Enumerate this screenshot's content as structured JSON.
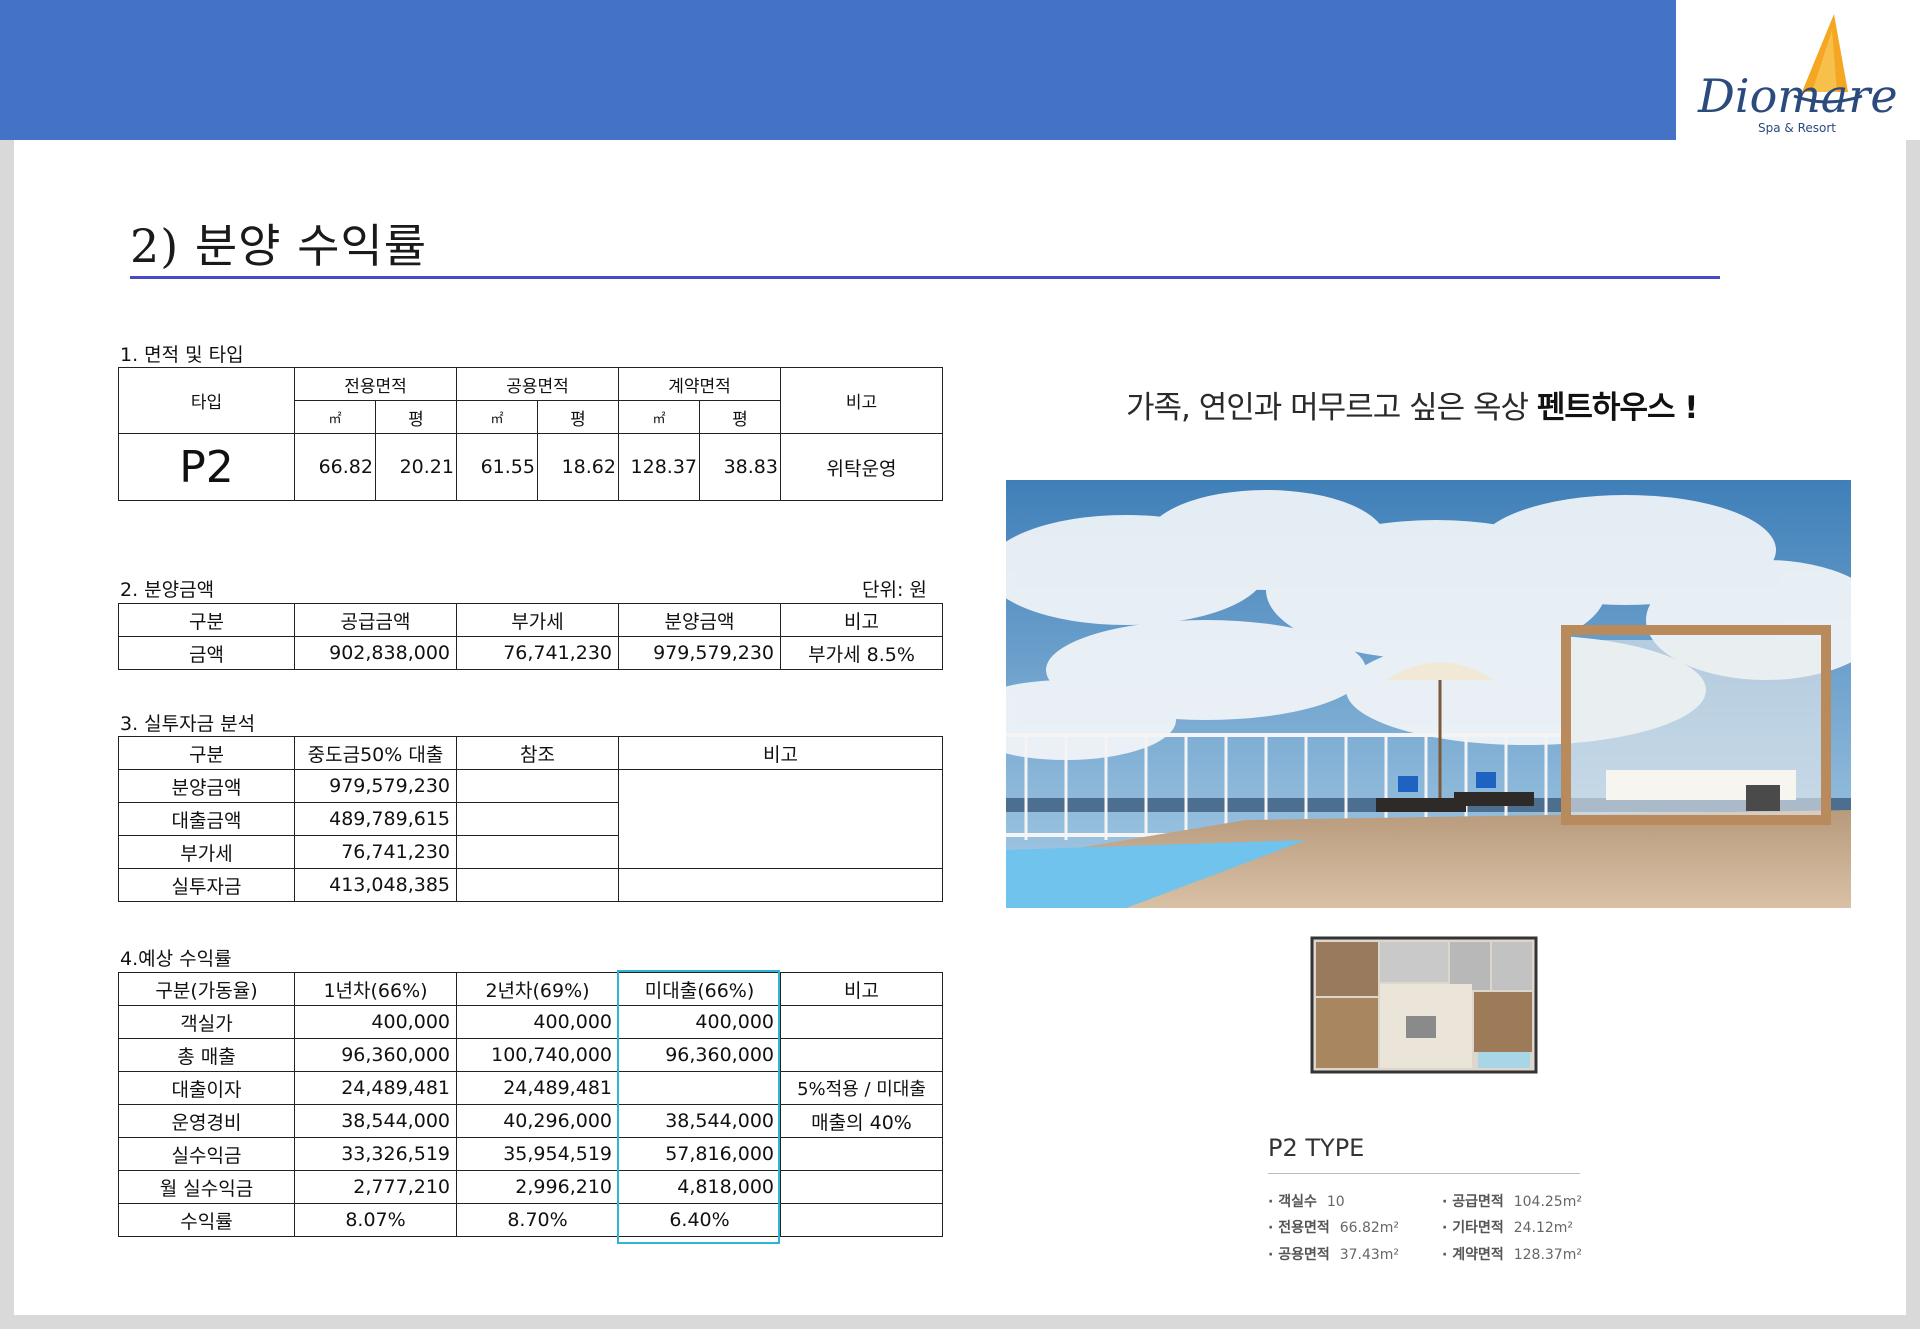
{
  "brand": {
    "name": "Diomare",
    "tagline": "Spa & Resort",
    "colors": {
      "header": "#4472c4",
      "logo_blue": "#2b4a7e",
      "sail_orange": "#f5a623"
    }
  },
  "page_title": "2) 분양 수익률",
  "area": {
    "label": "1. 면적 및 타입",
    "headers": {
      "type": "타입",
      "exclusive": "전용면적",
      "common": "공용면적",
      "contract": "계약면적",
      "note": "비고",
      "sqm": "㎡",
      "pyeong": "평"
    },
    "row": {
      "type": "P2",
      "exclusive_sqm": "66.82",
      "exclusive_py": "20.21",
      "common_sqm": "61.55",
      "common_py": "18.62",
      "contract_sqm": "128.37",
      "contract_py": "38.83",
      "note": "위탁운영"
    }
  },
  "price": {
    "label": "2. 분양금액",
    "unit": "단위: 원",
    "headers": [
      "구분",
      "공급금액",
      "부가세",
      "분양금액",
      "비고"
    ],
    "row": [
      "금액",
      "902,838,000",
      "76,741,230",
      "979,579,230",
      "부가세 8.5%"
    ]
  },
  "invest": {
    "label": "3. 실투자금 분석",
    "headers": [
      "구분",
      "중도금50% 대출",
      "참조",
      "비고"
    ],
    "rows": [
      [
        "분양금액",
        "979,579,230"
      ],
      [
        "대출금액",
        "489,789,615"
      ],
      [
        "부가세",
        "76,741,230"
      ],
      [
        "실투자금",
        "413,048,385"
      ]
    ]
  },
  "returns": {
    "label": "4.예상 수익률",
    "headers": [
      "구분(가동율)",
      "1년차(66%)",
      "2년차(69%)",
      "미대출(66%)",
      "비고"
    ],
    "rows": [
      [
        "객실가",
        "400,000",
        "400,000",
        "400,000",
        ""
      ],
      [
        "총 매출",
        "96,360,000",
        "100,740,000",
        "96,360,000",
        ""
      ],
      [
        "대출이자",
        "24,489,481",
        "24,489,481",
        "",
        "5%적용 / 미대출"
      ],
      [
        "운영경비",
        "38,544,000",
        "40,296,000",
        "38,544,000",
        "매출의 40%"
      ],
      [
        "실수익금",
        "33,326,519",
        "35,954,519",
        "57,816,000",
        ""
      ],
      [
        "월 실수익금",
        "2,777,210",
        "2,996,210",
        "4,818,000",
        ""
      ],
      [
        "수익률",
        "8.07%",
        "8.70%",
        "6.40%",
        ""
      ]
    ]
  },
  "headline": {
    "normal": "가족, 연인과 머무르고 싶은 옥상 ",
    "bold": "펜트하우스 !"
  },
  "ptype": {
    "title": "P2 TYPE",
    "specs": [
      {
        "k": "· 객실수",
        "v": "10"
      },
      {
        "k": "· 공급면적",
        "v": "104.25m²"
      },
      {
        "k": "· 전용면적",
        "v": "66.82m²"
      },
      {
        "k": "· 기타면적",
        "v": "24.12m²"
      },
      {
        "k": "· 공용면적",
        "v": "37.43m²"
      },
      {
        "k": "· 계약면적",
        "v": "128.37m²"
      }
    ]
  }
}
